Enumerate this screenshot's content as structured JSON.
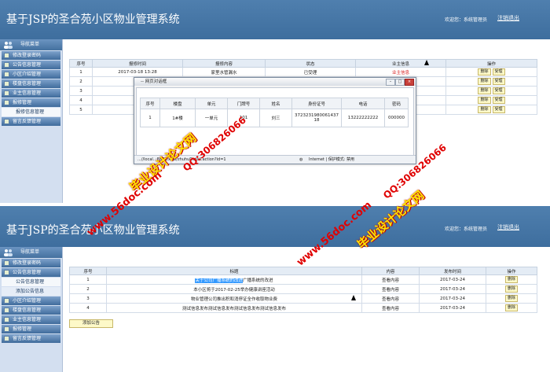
{
  "app_title": "基于JSP的圣合苑小区物业管理系统",
  "welcome": "欢迎您：系统管理员",
  "logout": "注销退出",
  "nav_header": "导航菜单",
  "top": {
    "menu": [
      "修改登录密码",
      "公告信息管理",
      "小区介绍管理",
      "楼盘信息管理",
      "业主信息管理",
      "报修管理"
    ],
    "submenu": [
      "报修信息管理"
    ],
    "menu_after": [
      "留言反馈管理"
    ],
    "columns": [
      "序号",
      "报修时间",
      "报修内容",
      "状态",
      "业主信息",
      "操作"
    ],
    "rows": [
      {
        "no": "1",
        "time": "2017-03-18 13:28",
        "content": "家里水管漏水",
        "status": "已受理",
        "owner": "业主信息"
      },
      {
        "no": "2",
        "time": "",
        "content": "",
        "status": "",
        "owner": ""
      },
      {
        "no": "3",
        "time": "",
        "content": "",
        "status": "",
        "owner": ""
      },
      {
        "no": "4",
        "time": "",
        "content": "",
        "status": "",
        "owner": ""
      },
      {
        "no": "5",
        "time": "",
        "content": "",
        "status": "",
        "owner": ""
      }
    ],
    "btn_delete": "删除",
    "btn_accept": "受理"
  },
  "dialog": {
    "title": "-- 网页对话框",
    "columns": [
      "序号",
      "楼盘",
      "单元",
      "门牌号",
      "姓名",
      "身份证号",
      "电话",
      "密码"
    ],
    "row": {
      "no": "1",
      "building": "1#楼",
      "unit": "一单元",
      "door": "101",
      "name": "刘三",
      "id": "372323198006143718",
      "phone": "13222222222",
      "pwd": "000000"
    },
    "status_url": "...//local..:8888/xqw/zhuhuDetail.action?id=1",
    "status_zone": "Internet | 保护模式: 禁用"
  },
  "bottom": {
    "menu_top": [
      "修改登录密码",
      "公告信息管理"
    ],
    "submenu": [
      "公告信息管理",
      "添加公告信息"
    ],
    "menu_after": [
      "小区介绍管理",
      "楼盘信息管理",
      "业主信息管理",
      "报修管理",
      "留言反馈管理"
    ],
    "columns": [
      "序号",
      "标题",
      "内容",
      "发布时间",
      "操作"
    ],
    "rows": [
      {
        "no": "1",
        "title_hl": "关于公司广播系统的改进",
        "title_rest": "广播系统的改进",
        "content": "查看内容",
        "date": "2017-03-24"
      },
      {
        "no": "2",
        "title_hl": "",
        "title_rest": "本小区将于2017-02-25举办健康讲座活动",
        "content": "查看内容",
        "date": "2017-03-24"
      },
      {
        "no": "3",
        "title_hl": "",
        "title_rest": "物业管理公司推出积和消停证全作收取物业费",
        "content": "查看内容",
        "date": "2017-03-24"
      },
      {
        "no": "4",
        "title_hl": "",
        "title_rest": "测试信息发布测试信息发布测试信息发布测试信息发布",
        "content": "查看内容",
        "date": "2017-03-24"
      }
    ],
    "btn_delete": "删除",
    "add_button": "添加公告"
  },
  "watermarks": {
    "site": "www.56doc.com",
    "qq": "QQ:306826066",
    "brand": "毕业设计论文网"
  },
  "colors": {
    "header": "#4a7aab",
    "accent_red": "#d82020",
    "button_bg": "#fdf9c8",
    "highlight": "#3399ff"
  }
}
